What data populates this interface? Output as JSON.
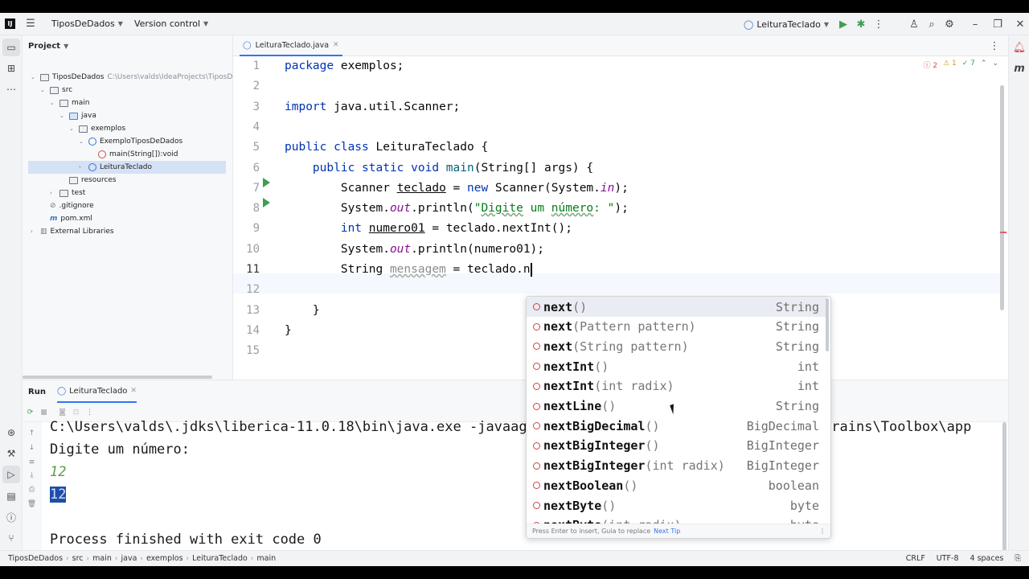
{
  "titlebar": {
    "project": "TiposDeDados",
    "vcs": "Version control",
    "run_config": "LeituraTeclado"
  },
  "project_panel": {
    "title": "Project",
    "tree": [
      {
        "label": "TiposDeDados",
        "hint": "C:\\Users\\valds\\IdeaProjects\\TiposDeDa",
        "indent": 0,
        "kind": "folder",
        "arrow": "open"
      },
      {
        "label": "src",
        "hint": "",
        "indent": 1,
        "kind": "folder",
        "arrow": "open"
      },
      {
        "label": "main",
        "hint": "",
        "indent": 2,
        "kind": "folder",
        "arrow": "open"
      },
      {
        "label": "java",
        "hint": "",
        "indent": 3,
        "kind": "folder-blue",
        "arrow": "open"
      },
      {
        "label": "exemplos",
        "hint": "",
        "indent": 4,
        "kind": "folder",
        "arrow": "open"
      },
      {
        "label": "ExemploTiposDeDados",
        "hint": "",
        "indent": 5,
        "kind": "class",
        "arrow": "open"
      },
      {
        "label": "main(String[]):void",
        "hint": "",
        "indent": 6,
        "kind": "method",
        "arrow": ""
      },
      {
        "label": "LeituraTeclado",
        "hint": "",
        "indent": 5,
        "kind": "class",
        "arrow": "closed",
        "selected": true
      },
      {
        "label": "resources",
        "hint": "",
        "indent": 3,
        "kind": "folder",
        "arrow": ""
      },
      {
        "label": "test",
        "hint": "",
        "indent": 2,
        "kind": "folder",
        "arrow": "closed"
      },
      {
        "label": ".gitignore",
        "hint": "",
        "indent": 1,
        "kind": "file",
        "arrow": ""
      },
      {
        "label": "pom.xml",
        "hint": "",
        "indent": 1,
        "kind": "maven",
        "arrow": ""
      },
      {
        "label": "External Libraries",
        "hint": "",
        "indent": 0,
        "kind": "lib",
        "arrow": "closed"
      }
    ]
  },
  "editor": {
    "tab": "LeituraTeclado.java",
    "inspections": {
      "errors": "2",
      "warnings": "1",
      "ok": "7"
    },
    "line_numbers": [
      "1",
      "2",
      "3",
      "4",
      "5",
      "6",
      "7",
      "8",
      "9",
      "10",
      "11",
      "12",
      "13",
      "14",
      "15"
    ]
  },
  "completion": {
    "items": [
      {
        "name": "next",
        "params": "()",
        "type": "String"
      },
      {
        "name": "next",
        "params": "(Pattern pattern)",
        "type": "String"
      },
      {
        "name": "next",
        "params": "(String pattern)",
        "type": "String"
      },
      {
        "name": "nextInt",
        "params": "()",
        "type": "int"
      },
      {
        "name": "nextInt",
        "params": "(int radix)",
        "type": "int"
      },
      {
        "name": "nextLine",
        "params": "()",
        "type": "String"
      },
      {
        "name": "nextBigDecimal",
        "params": "()",
        "type": "BigDecimal"
      },
      {
        "name": "nextBigInteger",
        "params": "()",
        "type": "BigInteger"
      },
      {
        "name": "nextBigInteger",
        "params": "(int radix)",
        "type": "BigInteger"
      },
      {
        "name": "nextBoolean",
        "params": "()",
        "type": "boolean"
      },
      {
        "name": "nextByte",
        "params": "()",
        "type": "byte"
      },
      {
        "name": "nextByte",
        "params": "(int radix)",
        "type": "byte"
      }
    ],
    "footer": "Press Enter to insert, Guia to replace",
    "footer_link": "Next Tip"
  },
  "run_panel": {
    "tab_run": "Run",
    "tab_config": "LeituraTeclado",
    "console": {
      "cmd": "C:\\Users\\valds\\.jdks\\liberica-11.0.18\\bin\\java.exe -javaagent:C:\\Users\\valds\\AppData\\Local\\JetBrains\\Toolbox\\app",
      "prompt": "Digite um número:",
      "input": "12",
      "output": "12",
      "finish": "Process finished with exit code 0"
    }
  },
  "statusbar": {
    "crumbs": [
      "TiposDeDados",
      "src",
      "main",
      "java",
      "exemplos",
      "LeituraTeclado",
      "main"
    ],
    "line_sep": "CRLF",
    "encoding": "UTF-8",
    "indent": "4 spaces"
  }
}
